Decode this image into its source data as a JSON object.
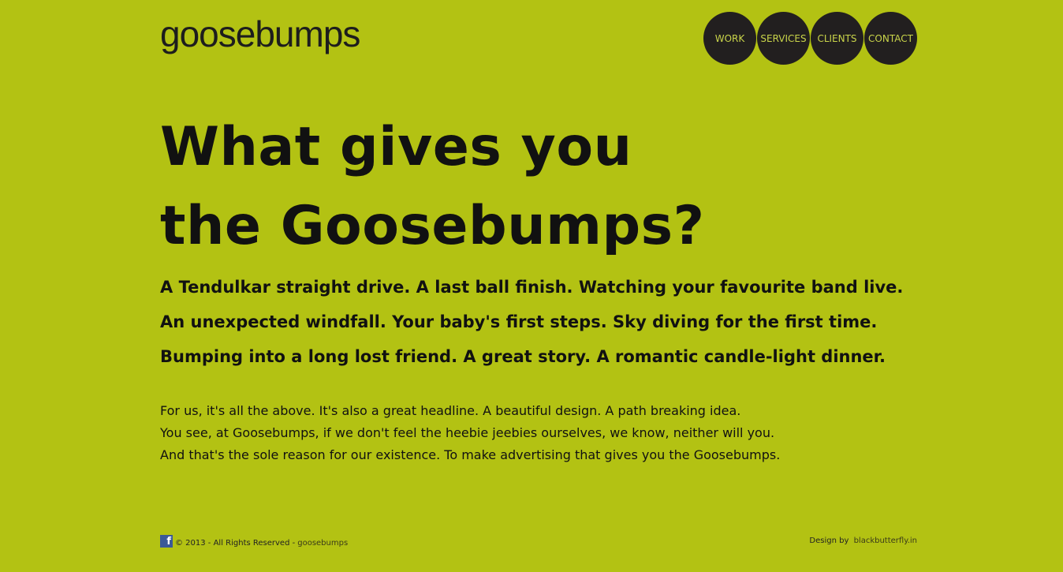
{
  "header": {
    "logo_text": "goosebumps"
  },
  "nav": {
    "items": [
      {
        "label": "WORK"
      },
      {
        "label": "SERVICES"
      },
      {
        "label": "CLIENTS"
      },
      {
        "label": "CONTACT"
      }
    ]
  },
  "hero": {
    "headline_line1": "What gives you",
    "headline_line2": "the Goosebumps?",
    "sub_lines": [
      "A Tendulkar straight drive. A last ball finish. Watching your favourite band live.",
      "An unexpected windfall. Your baby's first steps. Sky diving for the first time.",
      "Bumping into a long lost friend. A great story. A romantic candle-light dinner."
    ],
    "body_lines": [
      "For us, it's all the above. It's also a great headline. A beautiful design. A path breaking idea.",
      "You see, at Goosebumps, if we don't feel the heebie jeebies ourselves, we know, neither will you.",
      "And that's the sole reason for our existence. To make advertising that gives you the Goosebumps."
    ]
  },
  "footer": {
    "facebook_icon": "facebook-icon",
    "facebook_glyph": "f",
    "copyright": "© 2013 - All Rights Reserved -",
    "brand_link": "goosebumps",
    "design_label": "Design by",
    "designer_link": "blackbutterfly.in"
  },
  "colors": {
    "background": "#b3c213",
    "nav_circle": "#221f1f",
    "nav_text": "#c9d44a",
    "text": "#111111"
  }
}
